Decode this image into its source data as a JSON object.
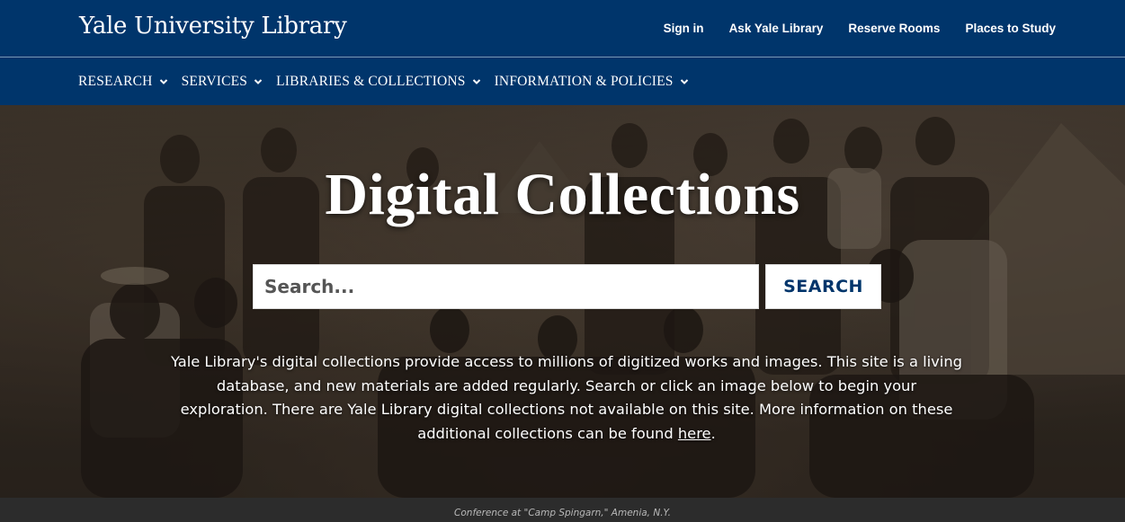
{
  "header": {
    "logo_text": "Yale University Library",
    "utility_links": [
      "Sign in",
      "Ask Yale Library",
      "Reserve Rooms",
      "Places to Study"
    ]
  },
  "nav": {
    "items": [
      "RESEARCH",
      "SERVICES",
      "LIBRARIES & COLLECTIONS",
      "INFORMATION & POLICIES"
    ]
  },
  "hero": {
    "title": "Digital Collections",
    "search_placeholder": "Search...",
    "search_button": "SEARCH",
    "description": "Yale Library's digital collections provide access to millions of digitized works and images. This site is a living database, and new materials are added regularly. Search or click an image below to begin your exploration. There are Yale Library digital collections not available on this site. More information on these additional collections can be found ",
    "description_link": "here",
    "description_end": ".",
    "caption": "Conference at \"Camp Spingarn,\" Amenia, N.Y."
  },
  "colors": {
    "brand_blue": "#00356b",
    "white": "#ffffff",
    "caption_bg": "#2c2c2c"
  },
  "icons": {
    "nav_chevron": "chevron-down-icon"
  }
}
